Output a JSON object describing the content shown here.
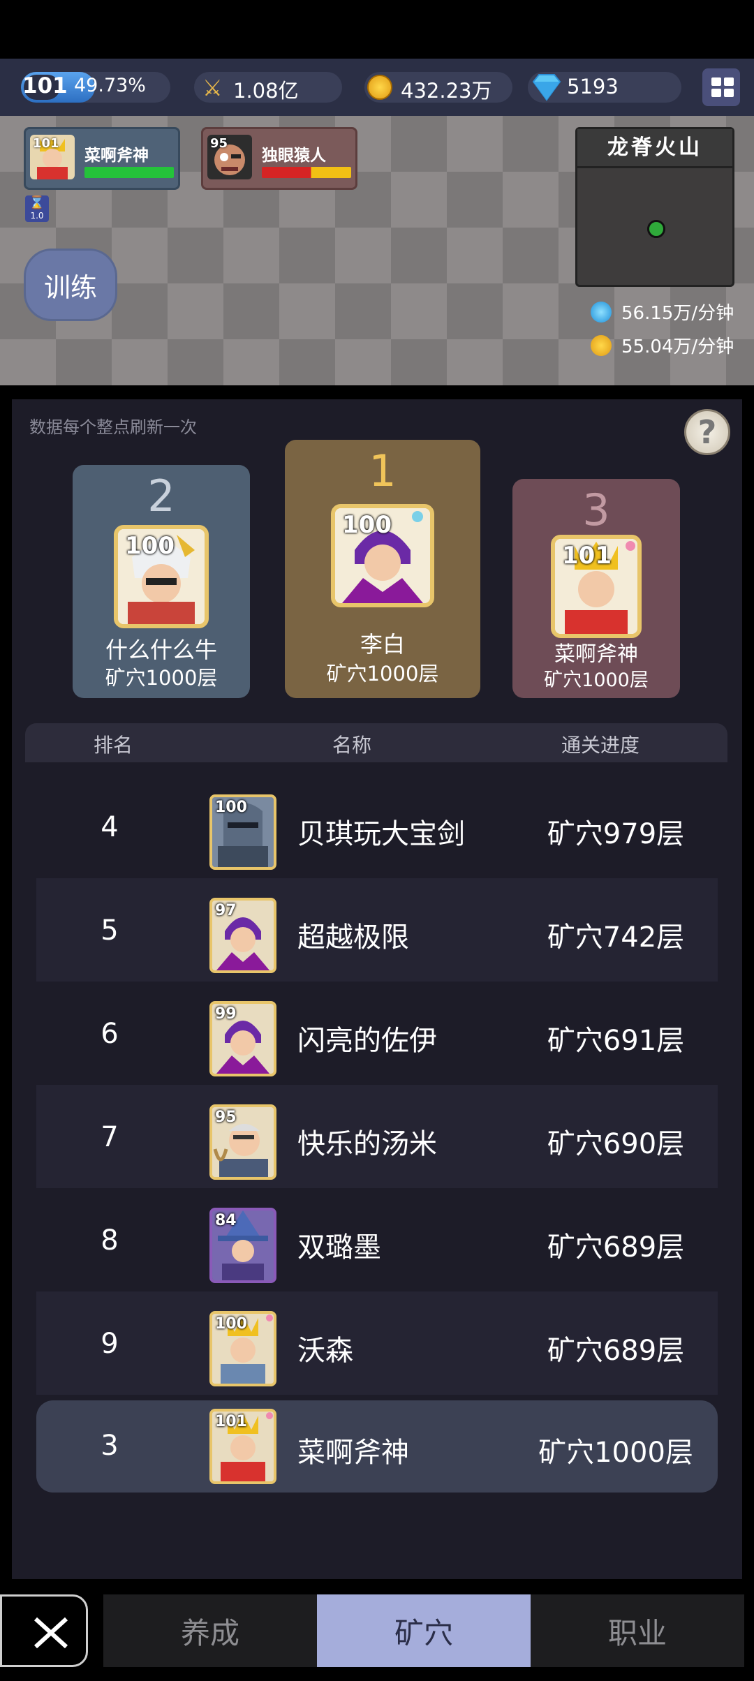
{
  "status_bar": {
    "level": "101",
    "exp_percent_text": "49.73%",
    "exp_fraction": 0.4973,
    "power": "1.08亿",
    "gold": "432.23万",
    "gems": "5193",
    "menu_icon": "grid-icon"
  },
  "scene": {
    "player": {
      "level": "101",
      "name": "菜啊斧神",
      "hp_fraction": 1.0
    },
    "enemy": {
      "level": "95",
      "name": "独眼猿人",
      "hp_fraction": 0.55
    },
    "speed_label": "1.0",
    "train_label": "训练",
    "map_name": "龙脊火山",
    "exp_rate": "56.15万/分钟",
    "gold_rate": "55.04万/分钟"
  },
  "panel": {
    "note": "数据每个整点刷新一次",
    "help": "?",
    "podium": [
      {
        "rank": "2",
        "level": "100",
        "name": "什么什么牛",
        "floor": "矿穴1000层"
      },
      {
        "rank": "1",
        "level": "100",
        "name": "李白",
        "floor": "矿穴1000层"
      },
      {
        "rank": "3",
        "level": "101",
        "name": "菜啊斧神",
        "floor": "矿穴1000层"
      }
    ],
    "headers": {
      "rank": "排名",
      "name": "名称",
      "progress": "通关进度"
    },
    "rows": [
      {
        "rank": "4",
        "level": "100",
        "name": "贝琪玩大宝剑",
        "progress": "矿穴979层"
      },
      {
        "rank": "5",
        "level": "97",
        "name": "超越极限",
        "progress": "矿穴742层"
      },
      {
        "rank": "6",
        "level": "99",
        "name": "闪亮的佐伊",
        "progress": "矿穴691层"
      },
      {
        "rank": "7",
        "level": "95",
        "name": "快乐的汤米",
        "progress": "矿穴690层"
      },
      {
        "rank": "8",
        "level": "84",
        "name": "双璐墨",
        "progress": "矿穴689层"
      },
      {
        "rank": "9",
        "level": "100",
        "name": "沃森",
        "progress": "矿穴689层"
      }
    ],
    "self_row": {
      "rank": "3",
      "level": "101",
      "name": "菜啊斧神",
      "progress": "矿穴1000层"
    }
  },
  "tabs": [
    "养成",
    "矿穴",
    "职业"
  ],
  "active_tab": "矿穴",
  "colors": {
    "panel": "#1d1c28",
    "tab_active": "#a5addb",
    "gold": "#e8c56a"
  }
}
